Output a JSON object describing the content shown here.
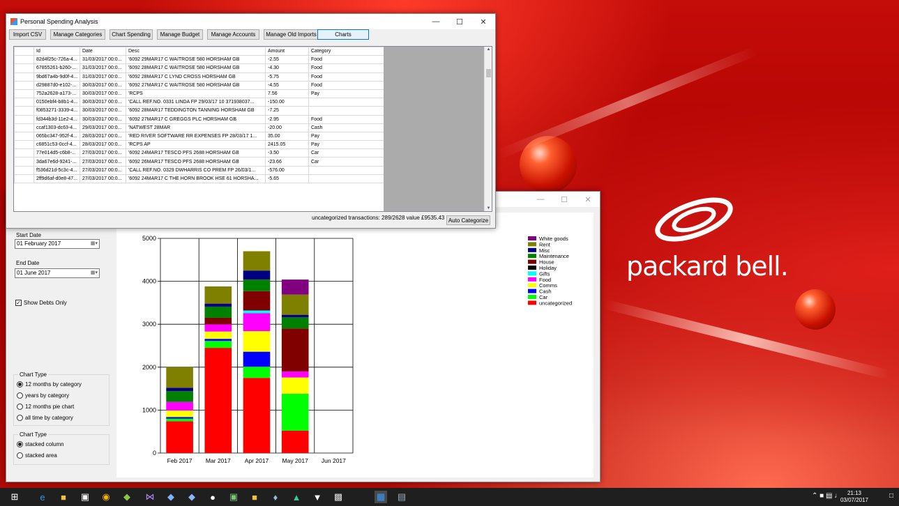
{
  "colors": {
    "White goods": "#800080",
    "Rent": "#808000",
    "Misc": "#000080",
    "Maintenance": "#008000",
    "House": "#800000",
    "Holiday": "#000000",
    "Gifts": "#00ffff",
    "Food": "#ff00ff",
    "Comms": "#ffff00",
    "Cash": "#0000ff",
    "Car": "#00ff00",
    "uncategorized": "#ff0000"
  },
  "desktop": {
    "brand": "packard bell."
  },
  "main_window": {
    "title": "Personal Spending Analysis",
    "toolbar": [
      "Import CSV",
      "Manage Categories",
      "Chart Spending",
      "Manage Budget",
      "Manage Accounts",
      "Manage Old Imports",
      "Charts"
    ],
    "columns": [
      "",
      "Id",
      "Date",
      "Desc",
      "Amount",
      "Category"
    ],
    "rows": [
      [
        "82d4f25c-726a-4...",
        "31/03/2017 00:0...",
        "'6092 29MAR17 C  WAITROSE 580  HORSHAM GB",
        "-2.55",
        "Food"
      ],
      [
        "67855261-b260-...",
        "31/03/2017 00:0...",
        "'6092 28MAR17 C  WAITROSE 580  HORSHAM GB",
        "-4.30",
        "Food"
      ],
      [
        "9bd67a4b-9d0f-4...",
        "31/03/2017 00:0...",
        "'6092 28MAR17 C  LYND CROSS  HORSHAM GB",
        "-5.75",
        "Food"
      ],
      [
        "d29887d0-e102-...",
        "30/03/2017 00:0...",
        "'6092 27MAR17 C  WAITROSE 580  HORSHAM GB",
        "-4.55",
        "Food"
      ],
      [
        "752a2628-a173-...",
        "30/03/2017 00:0...",
        "'RCPS",
        "7.56",
        "Pay"
      ],
      [
        "0150ebf4-b8b1-4...",
        "30/03/2017 00:0...",
        "'CALL REF.NO. 0331  LINDA  FP 29/03/17 10  371938037...",
        "-150.00",
        ""
      ],
      [
        "f0853271-3339-4...",
        "30/03/2017 00:0...",
        "'6092 28MAR17  TEDDINGTON TANNING HORSHAM GB",
        "-7.25",
        ""
      ],
      [
        "fd344b3d-11e2-4...",
        "30/03/2017 00:0...",
        "'6092 27MAR17 C  GREGGS PLC  HORSHAM GB",
        "-2.95",
        "Food"
      ],
      [
        "ccaf1303-dc63-4...",
        "29/03/2017 00:0...",
        "'NATWEST 28MAR",
        "-20.00",
        "Cash"
      ],
      [
        "065bc347-952f-4...",
        "28/03/2017 00:0...",
        "'RED RIVER SOFTWARE RR EXPENSES  FP 28/03/17 1...",
        "35.00",
        "Pay"
      ],
      [
        "c6851c53-0ccf-4...",
        "28/03/2017 00:0...",
        "'RCPS AP",
        "2415.05",
        "Pay"
      ],
      [
        "77e014d5-c6b8-...",
        "27/03/2017 00:0...",
        "'6092 24MAR17  TESCO PFS 2688  HORSHAM GB",
        "-3.50",
        "Car"
      ],
      [
        "3da67e6d-9241-...",
        "27/03/2017 00:0...",
        "'6092 26MAR17  TESCO PFS 2688  HORSHAM GB",
        "-23.66",
        "Car"
      ],
      [
        "f536d21d-5c3c-4...",
        "27/03/2017 00:0...",
        "'CALL REF.NO. 0329  DWHARRIS CO PREM  FP 26/03/1...",
        "-576.00",
        ""
      ],
      [
        "2ff9d6af-d0e8-47...",
        "27/03/2017 00:0...",
        "'6092 24MAR17 C  THE HORN BROOK HSE 61  HORSHA...",
        "-5.65",
        ""
      ]
    ],
    "status": "uncategorized transactions: 289/2628 value £9535.43",
    "auto_categorize": "Auto Categorize"
  },
  "chart_window": {
    "start_date_label": "Start Date",
    "start_date": "01 February  2017",
    "end_date_label": "End Date",
    "end_date": "01   June   2017",
    "show_debits": "Show Debts Only",
    "chart_type_group1": {
      "title": "Chart Type",
      "options": [
        "12 months by category",
        "years by category",
        "12 months pie chart",
        "all time by category"
      ]
    },
    "chart_type_group2": {
      "title": "Chart Type",
      "options": [
        "stacked column",
        "stacked area"
      ]
    }
  },
  "chart_data": {
    "type": "bar",
    "stacked": true,
    "categories": [
      "Feb 2017",
      "Mar 2017",
      "Apr 2017",
      "May 2017",
      "Jun 2017"
    ],
    "ylim": [
      0,
      5000
    ],
    "yticks": [
      0,
      1000,
      2000,
      3000,
      4000,
      5000
    ],
    "legend_position": "right",
    "series": [
      {
        "name": "uncategorized",
        "values": [
          740,
          2450,
          1750,
          520,
          0
        ]
      },
      {
        "name": "Car",
        "values": [
          60,
          160,
          260,
          860,
          0
        ]
      },
      {
        "name": "Cash",
        "values": [
          40,
          50,
          350,
          0,
          0
        ]
      },
      {
        "name": "Comms",
        "values": [
          150,
          170,
          480,
          380,
          0
        ]
      },
      {
        "name": "Food",
        "values": [
          200,
          170,
          420,
          140,
          0
        ]
      },
      {
        "name": "Gifts",
        "values": [
          0,
          0,
          60,
          0,
          0
        ]
      },
      {
        "name": "Holiday",
        "values": [
          0,
          0,
          0,
          0,
          0
        ]
      },
      {
        "name": "House",
        "values": [
          0,
          150,
          450,
          1000,
          0
        ]
      },
      {
        "name": "Maintenance",
        "values": [
          250,
          260,
          270,
          260,
          0
        ]
      },
      {
        "name": "Misc",
        "values": [
          80,
          70,
          210,
          60,
          0
        ]
      },
      {
        "name": "Rent",
        "values": [
          480,
          400,
          450,
          470,
          0
        ]
      },
      {
        "name": "White goods",
        "values": [
          0,
          0,
          0,
          350,
          0
        ]
      }
    ]
  },
  "taskbar": {
    "time": "21:13",
    "date": "03/07/2017"
  }
}
